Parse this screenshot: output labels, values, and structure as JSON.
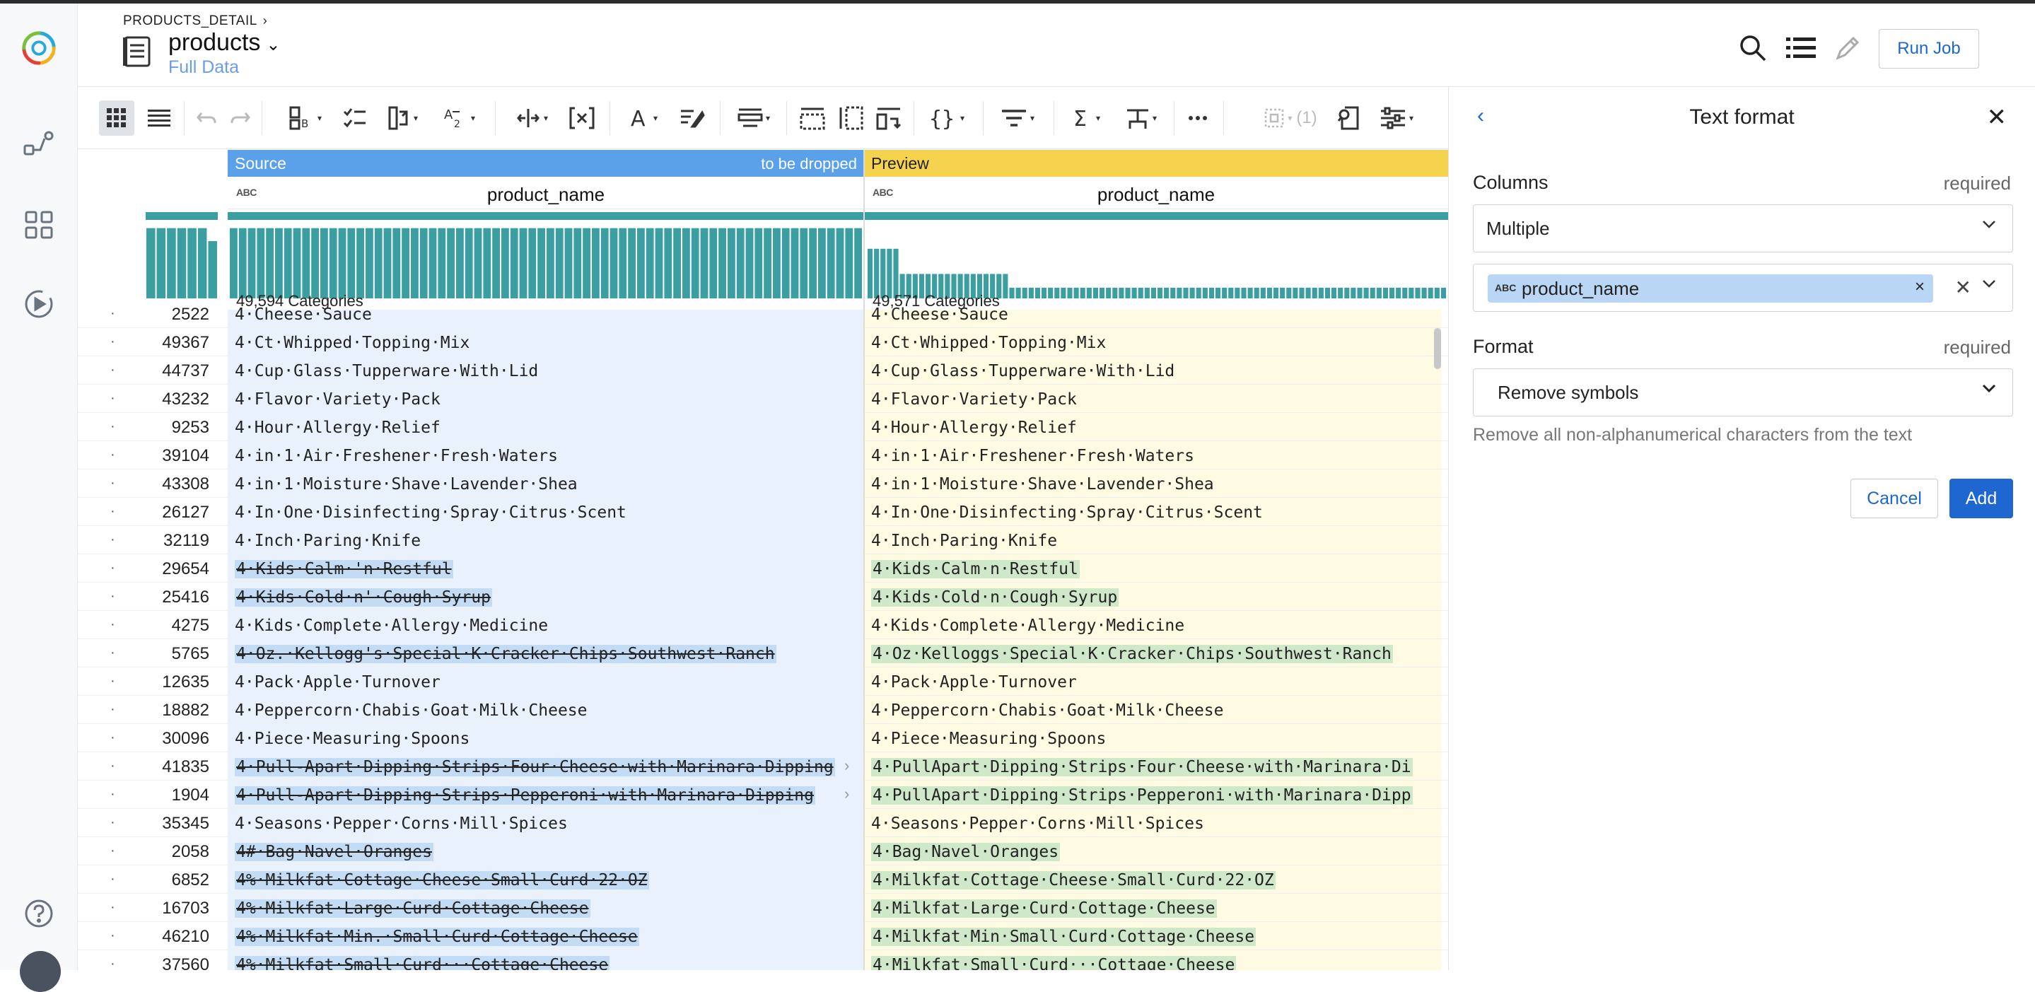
{
  "header": {
    "breadcrumb": "PRODUCTS_DETAIL",
    "dataset_name": "products",
    "dataset_sub": "Full Data",
    "run_job": "Run Job"
  },
  "toolbar": {
    "lookup_count": "(1)"
  },
  "grid": {
    "source_label": "Source",
    "source_note": "to be dropped",
    "preview_label": "Preview",
    "type_badge": "ABC",
    "source_column": "product_name",
    "preview_column": "product_name",
    "source_categories": "49,594 Categories",
    "preview_categories": "49,571 Categories",
    "rows": [
      {
        "id": "2522",
        "src": "4·Cheese·Sauce",
        "prev": "4·Cheese·Sauce",
        "changed": false
      },
      {
        "id": "49367",
        "src": "4·Ct·Whipped·Topping·Mix",
        "prev": "4·Ct·Whipped·Topping·Mix",
        "changed": false
      },
      {
        "id": "44737",
        "src": "4·Cup·Glass·Tupperware·With·Lid",
        "prev": "4·Cup·Glass·Tupperware·With·Lid",
        "changed": false
      },
      {
        "id": "43232",
        "src": "4·Flavor·Variety·Pack",
        "prev": "4·Flavor·Variety·Pack",
        "changed": false
      },
      {
        "id": "9253",
        "src": "4·Hour·Allergy·Relief",
        "prev": "4·Hour·Allergy·Relief",
        "changed": false
      },
      {
        "id": "39104",
        "src": "4·in·1·Air·Freshener·Fresh·Waters",
        "prev": "4·in·1·Air·Freshener·Fresh·Waters",
        "changed": false
      },
      {
        "id": "43308",
        "src": "4·in·1·Moisture·Shave·Lavender·Shea",
        "prev": "4·in·1·Moisture·Shave·Lavender·Shea",
        "changed": false
      },
      {
        "id": "26127",
        "src": "4·In·One·Disinfecting·Spray·Citrus·Scent",
        "prev": "4·In·One·Disinfecting·Spray·Citrus·Scent",
        "changed": false
      },
      {
        "id": "32119",
        "src": "4·Inch·Paring·Knife",
        "prev": "4·Inch·Paring·Knife",
        "changed": false
      },
      {
        "id": "29654",
        "src": "4·Kids·Calm·'n·Restful",
        "prev": "4·Kids·Calm·n·Restful",
        "changed": true
      },
      {
        "id": "25416",
        "src": "4·Kids·Cold·n'·Cough·Syrup",
        "prev": "4·Kids·Cold·n·Cough·Syrup",
        "changed": true
      },
      {
        "id": "4275",
        "src": "4·Kids·Complete·Allergy·Medicine",
        "prev": "4·Kids·Complete·Allergy·Medicine",
        "changed": false
      },
      {
        "id": "5765",
        "src": "4·Oz.·Kellogg's·Special·K·Cracker·Chips·Southwest·Ranch",
        "prev": "4·Oz·Kelloggs·Special·K·Cracker·Chips·Southwest·Ranch",
        "changed": true
      },
      {
        "id": "12635",
        "src": "4·Pack·Apple·Turnover",
        "prev": "4·Pack·Apple·Turnover",
        "changed": false
      },
      {
        "id": "18882",
        "src": "4·Peppercorn·Chabis·Goat·Milk·Cheese",
        "prev": "4·Peppercorn·Chabis·Goat·Milk·Cheese",
        "changed": false
      },
      {
        "id": "30096",
        "src": "4·Piece·Measuring·Spoons",
        "prev": "4·Piece·Measuring·Spoons",
        "changed": false
      },
      {
        "id": "41835",
        "src": "4·Pull-Apart·Dipping·Strips·Four·Cheese·with·Marinara·Dipping",
        "prev": "4·PullApart·Dipping·Strips·Four·Cheese·with·Marinara·Di",
        "changed": true,
        "more": true
      },
      {
        "id": "1904",
        "src": "4·Pull-Apart·Dipping·Strips·Pepperoni·with·Marinara·Dipping",
        "prev": "4·PullApart·Dipping·Strips·Pepperoni·with·Marinara·Dipp",
        "changed": true,
        "more": true
      },
      {
        "id": "35345",
        "src": "4·Seasons·Pepper·Corns·Mill·Spices",
        "prev": "4·Seasons·Pepper·Corns·Mill·Spices",
        "changed": false
      },
      {
        "id": "2058",
        "src": "4#·Bag·Navel·Oranges",
        "prev": "4·Bag·Navel·Oranges",
        "changed": true
      },
      {
        "id": "6852",
        "src": "4%·Milkfat·Cottage·Cheese·Small·Curd·22·OZ",
        "prev": "4·Milkfat·Cottage·Cheese·Small·Curd·22·OZ",
        "changed": true
      },
      {
        "id": "16703",
        "src": "4%·Milkfat·Large·Curd·Cottage·Cheese",
        "prev": "4·Milkfat·Large·Curd·Cottage·Cheese",
        "changed": true
      },
      {
        "id": "46210",
        "src": "4%·Milkfat·Min.·Small·Curd·Cottage·Cheese",
        "prev": "4·Milkfat·Min·Small·Curd·Cottage·Cheese",
        "changed": true
      },
      {
        "id": "37560",
        "src": "4%·Milkfat·Small·Curd···Cottage·Cheese",
        "prev": "4·Milkfat·Small·Curd···Cottage·Cheese",
        "changed": true
      }
    ]
  },
  "panel": {
    "title": "Text format",
    "columns_label": "Columns",
    "required": "required",
    "columns_mode": "Multiple",
    "chip_type": "ABC",
    "chip_name": "product_name",
    "format_label": "Format",
    "format_value": "Remove symbols",
    "help": "Remove all non-alphanumerical characters from the text",
    "cancel": "Cancel",
    "add": "Add"
  },
  "colors": {
    "accent": "#1e66d0",
    "source_band": "#5ba1ea",
    "preview_band": "#f6d34e",
    "bar": "#3b9ea1"
  }
}
